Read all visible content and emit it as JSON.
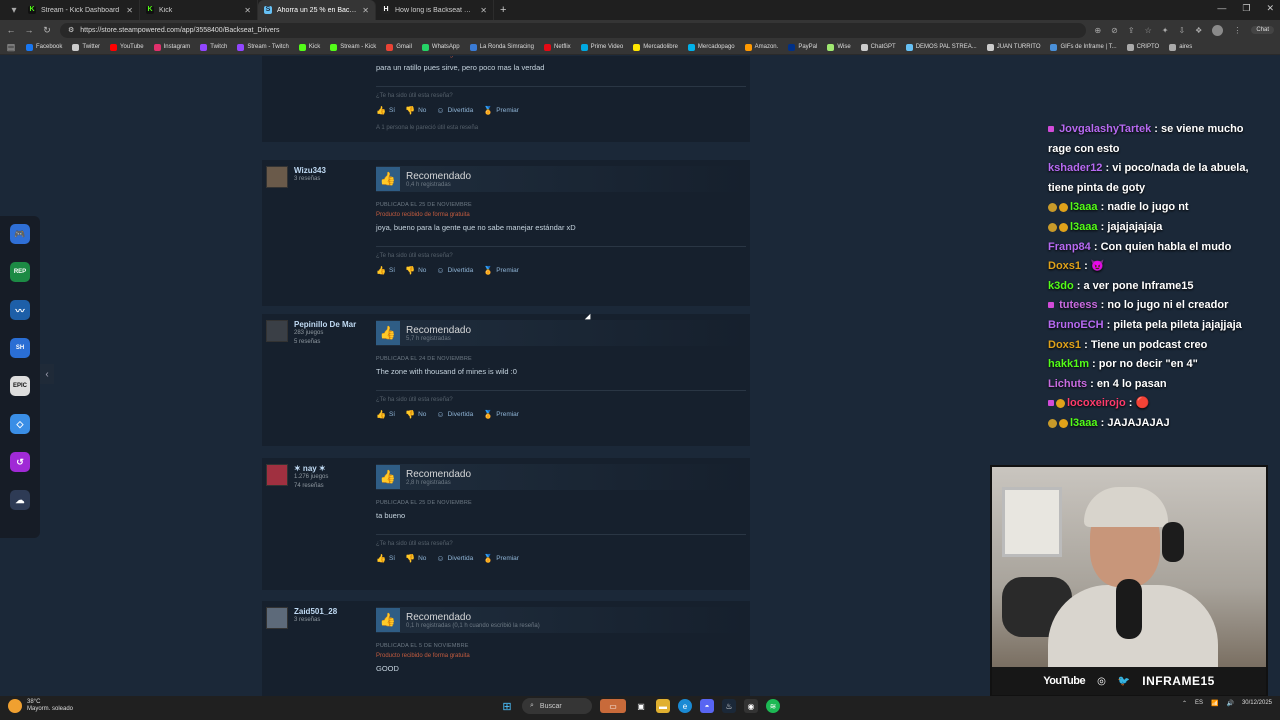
{
  "tabs": [
    {
      "label": "Stream - Kick Dashboard",
      "icon": "kick-icon",
      "active": false
    },
    {
      "label": "Kick",
      "icon": "kick-icon",
      "active": false
    },
    {
      "label": "Ahorra un 25 % en Backseat Drivers",
      "icon": "steam-icon",
      "active": true
    },
    {
      "label": "How long is Backseat Drivers? | H",
      "icon": "hltb-icon",
      "active": false
    }
  ],
  "address": {
    "url": "https://store.steampowered.com/app/3558400/Backseat_Drivers"
  },
  "address_right": {
    "chat_label": "Chat"
  },
  "bookmarks": [
    {
      "label": "Facebook",
      "color": "#1877f2"
    },
    {
      "label": "Twitter",
      "color": "#cccccc"
    },
    {
      "label": "YouTube",
      "color": "#ff0000"
    },
    {
      "label": "Instagram",
      "color": "#e1306c"
    },
    {
      "label": "Twitch",
      "color": "#9146ff"
    },
    {
      "label": "Stream - Twitch",
      "color": "#9146ff"
    },
    {
      "label": "Kick",
      "color": "#53fc18"
    },
    {
      "label": "Stream - Kick",
      "color": "#53fc18"
    },
    {
      "label": "Gmail",
      "color": "#ea4335"
    },
    {
      "label": "WhatsApp",
      "color": "#25d366"
    },
    {
      "label": "La Ronda Simracing",
      "color": "#3a7bd5"
    },
    {
      "label": "Netflix",
      "color": "#e50914"
    },
    {
      "label": "Prime Video",
      "color": "#00a8e1"
    },
    {
      "label": "Mercadolibre",
      "color": "#ffe600"
    },
    {
      "label": "Mercadopago",
      "color": "#00b1ea"
    },
    {
      "label": "Amazon.",
      "color": "#ff9900"
    },
    {
      "label": "PayPal",
      "color": "#003087"
    },
    {
      "label": "Wise",
      "color": "#9fe870"
    },
    {
      "label": "ChatGPT",
      "color": "#cccccc"
    },
    {
      "label": "DEMOS PAL STREA...",
      "color": "#66c0f4"
    },
    {
      "label": "JUAN TURRITO",
      "color": "#cccccc"
    },
    {
      "label": "GIFs de Inframe | T...",
      "color": "#4a90d9"
    },
    {
      "label": "CRIPTO",
      "color": "#aaaaaa"
    },
    {
      "label": "aires",
      "color": "#aaaaaa"
    }
  ],
  "reviews": [
    {
      "author": "",
      "meta": [],
      "title": "",
      "hours": "",
      "posted": "",
      "free": "Producto recibido de forma gratuita",
      "text": "para un ratillo pues sirve, pero poco mas la verdad",
      "helpful_q": "¿Te ha sido útil esta reseña?",
      "found": "A 1 persona le pareció útil esta reseña"
    },
    {
      "author": "Wizu343",
      "meta": [
        "3 reseñas"
      ],
      "title": "Recomendado",
      "hours": "0,4 h registradas",
      "posted": "PUBLICADA EL 25 DE NOVIEMBRE",
      "free": "Producto recibido de forma gratuita",
      "text": "joya, bueno para la gente que no sabe manejar estándar xD",
      "helpful_q": "¿Te ha sido útil esta reseña?",
      "found": ""
    },
    {
      "author": "Pepinillo De Mar",
      "meta": [
        "283 juegos",
        "5 reseñas"
      ],
      "title": "Recomendado",
      "hours": "5,7 h registradas",
      "posted": "PUBLICADA EL 24 DE NOVIEMBRE",
      "free": "",
      "text": "The zone with thousand of mines is wild :0",
      "helpful_q": "¿Te ha sido útil esta reseña?",
      "found": ""
    },
    {
      "author": "✶ nay ✶",
      "meta": [
        "1.276 juegos",
        "74 reseñas"
      ],
      "title": "Recomendado",
      "hours": "2,8 h registradas",
      "posted": "PUBLICADA EL 25 DE NOVIEMBRE",
      "free": "",
      "text": "ta bueno",
      "helpful_q": "¿Te ha sido útil esta reseña?",
      "found": ""
    },
    {
      "author": "Zaid501_28",
      "meta": [
        "3 reseñas"
      ],
      "title": "Recomendado",
      "hours": "0,1 h registradas (0,1 h cuando escribió la reseña)",
      "posted": "PUBLICADA EL 5 DE NOVIEMBRE",
      "free": "Producto recibido de forma gratuita",
      "text": "GOOD",
      "helpful_q": "",
      "found": ""
    }
  ],
  "votes": {
    "yes": "Sí",
    "no": "No",
    "funny": "Divertida",
    "award": "Premiar"
  },
  "chat": [
    {
      "user": "JovgalashyTartek",
      "color": "#b76af2",
      "badges": "sub",
      "msg": "se viene mucho rage con esto"
    },
    {
      "user": "kshader12",
      "color": "#b76af2",
      "badges": "",
      "msg": "vi poco/nada de la abuela, tiene pinta de goty"
    },
    {
      "user": "l3aaa",
      "color": "#53fc18",
      "badges": "gold",
      "msg": "nadie lo jugo nt"
    },
    {
      "user": "l3aaa",
      "color": "#53fc18",
      "badges": "gold",
      "msg": "jajajajajaja"
    },
    {
      "user": "Franp84",
      "color": "#b76af2",
      "badges": "",
      "msg": "Con quien habla el mudo"
    },
    {
      "user": "Doxs1",
      "color": "#e0a21a",
      "badges": "",
      "msg": "😈"
    },
    {
      "user": "k3do",
      "color": "#53fc18",
      "badges": "",
      "msg": "a ver pone Inframe15"
    },
    {
      "user": "tuteess",
      "color": "#c86be0",
      "badges": "sub",
      "msg": "no lo jugo ni el creador"
    },
    {
      "user": "BrunoECH",
      "color": "#b76af2",
      "badges": "",
      "msg": "pileta pela pileta jajajjaja"
    },
    {
      "user": "Doxs1",
      "color": "#e0a21a",
      "badges": "",
      "msg": "Tiene un podcast creo"
    },
    {
      "user": "hakk1m",
      "color": "#53fc18",
      "badges": "",
      "msg": "por no decir \"en 4\""
    },
    {
      "user": "Lichuts",
      "color": "#c86be0",
      "badges": "",
      "msg": "en 4 lo pasan"
    },
    {
      "user": "locoxeirojo",
      "color": "#ff3b6b",
      "badges": "sub-gold",
      "msg": "🔴"
    },
    {
      "user": "l3aaa",
      "color": "#53fc18",
      "badges": "gold",
      "msg": "JAJAJAJAJ"
    }
  ],
  "webcam": {
    "youtube": "YouTube",
    "brand": "INFRAME15"
  },
  "taskbar": {
    "search": "Buscar",
    "weather_temp": "38°C",
    "weather_desc": "Mayorm. soleado",
    "lang": "ES",
    "time": "30/12/2025"
  }
}
